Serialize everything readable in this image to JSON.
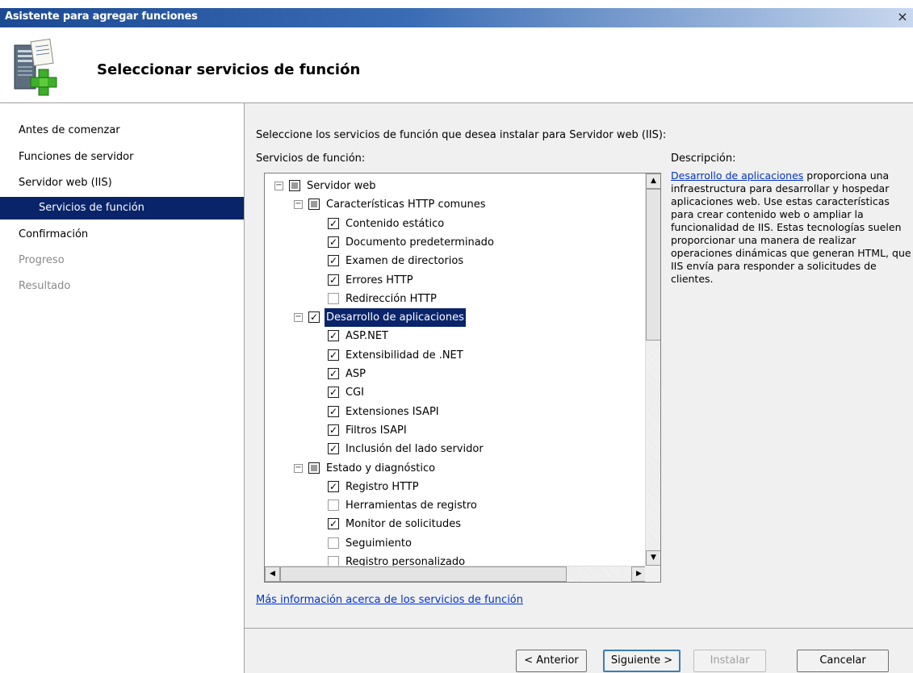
{
  "window": {
    "title": "Asistente para agregar funciones",
    "close_glyph": "×"
  },
  "header": {
    "title": "Seleccionar servicios de función",
    "icon": "server-add-icon"
  },
  "nav": {
    "items": [
      {
        "label": "Antes de comenzar",
        "state": "normal"
      },
      {
        "label": "Funciones de servidor",
        "state": "normal"
      },
      {
        "label": "Servidor web (IIS)",
        "state": "normal"
      },
      {
        "label": "Servicios de función",
        "state": "active"
      },
      {
        "label": "Confirmación",
        "state": "normal"
      },
      {
        "label": "Progreso",
        "state": "disabled"
      },
      {
        "label": "Resultado",
        "state": "disabled"
      }
    ]
  },
  "main": {
    "intro": "Seleccione los servicios de función que desea instalar para Servidor web (IIS):",
    "list_caption": "Servicios de función:",
    "desc_caption": "Descripción:",
    "desc_link": "Desarrollo de aplicaciones",
    "desc_text": " proporciona una infraestructura para desarrollar y hospedar aplicaciones web. Use estas características para crear contenido web o ampliar la funcionalidad de IIS. Estas tecnologías suelen proporcionar una manera de realizar operaciones dinámicas que generan HTML, que IIS envía para responder a solicitudes de clientes.",
    "more_link": "Más información acerca de los servicios de función"
  },
  "tree": [
    {
      "label": "Servidor web",
      "level": 0,
      "state": "partial",
      "expander": "−"
    },
    {
      "label": "Características HTTP comunes",
      "level": 1,
      "state": "partial",
      "expander": "−"
    },
    {
      "label": "Contenido estático",
      "level": 2,
      "state": "checked"
    },
    {
      "label": "Documento predeterminado",
      "level": 2,
      "state": "checked"
    },
    {
      "label": "Examen de directorios",
      "level": 2,
      "state": "checked"
    },
    {
      "label": "Errores HTTP",
      "level": 2,
      "state": "checked"
    },
    {
      "label": "Redirección HTTP",
      "level": 2,
      "state": "unchecked"
    },
    {
      "label": "Desarrollo de aplicaciones",
      "level": 1,
      "state": "checked",
      "expander": "−",
      "selected": true
    },
    {
      "label": "ASP.NET",
      "level": 2,
      "state": "checked"
    },
    {
      "label": "Extensibilidad de .NET",
      "level": 2,
      "state": "checked"
    },
    {
      "label": "ASP",
      "level": 2,
      "state": "checked"
    },
    {
      "label": "CGI",
      "level": 2,
      "state": "checked"
    },
    {
      "label": "Extensiones ISAPI",
      "level": 2,
      "state": "checked"
    },
    {
      "label": "Filtros ISAPI",
      "level": 2,
      "state": "checked"
    },
    {
      "label": "Inclusión del lado servidor",
      "level": 2,
      "state": "checked"
    },
    {
      "label": "Estado y diagnóstico",
      "level": 1,
      "state": "partial",
      "expander": "−"
    },
    {
      "label": "Registro HTTP",
      "level": 2,
      "state": "checked"
    },
    {
      "label": "Herramientas de registro",
      "level": 2,
      "state": "unchecked"
    },
    {
      "label": "Monitor de solicitudes",
      "level": 2,
      "state": "checked"
    },
    {
      "label": "Seguimiento",
      "level": 2,
      "state": "unchecked"
    },
    {
      "label": "Registro personalizado",
      "level": 2,
      "state": "unchecked"
    }
  ],
  "scroll": {
    "up": "▲",
    "down": "▼",
    "left": "◀",
    "right": "▶"
  },
  "buttons": {
    "back": "< Anterior",
    "next": "Siguiente >",
    "install": "Instalar",
    "cancel": "Cancelar"
  },
  "check_glyph": "✓"
}
